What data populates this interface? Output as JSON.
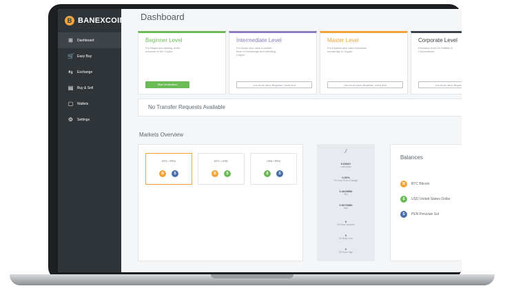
{
  "brand": {
    "name": "BANEXCOIN",
    "mark": "B"
  },
  "colors": {
    "accent": "#f0a43a",
    "green": "#6cbb57",
    "purple": "#8c7bbd",
    "blue": "#4b6fa8",
    "sidebar": "#2f3438"
  },
  "sidebar": {
    "items": [
      {
        "label": "Dashboard",
        "icon": "grid-icon",
        "glyph": "⊞",
        "active": true
      },
      {
        "label": "Easy Buy",
        "icon": "cart-icon",
        "glyph": "🛒",
        "active": false
      },
      {
        "label": "Exchange",
        "icon": "exchange-icon",
        "glyph": "⇆",
        "active": false
      },
      {
        "label": "Buy & Sell",
        "icon": "trade-icon",
        "glyph": "▤",
        "active": false
      },
      {
        "label": "Wallets",
        "icon": "wallet-icon",
        "glyph": "▢",
        "active": false
      },
      {
        "label": "Settings",
        "icon": "gear-icon",
        "glyph": "⚙",
        "active": false
      }
    ]
  },
  "main": {
    "title": "Dashboard",
    "levels": [
      {
        "title": "Beginner Level",
        "desc": "For Beginners starting at the universe of the Crypto.",
        "button": "Start Verification"
      },
      {
        "title": "Intermediate Level",
        "desc": "For those who have a certain level of knowledge and handling Crypto.",
        "button": "You must have Beginner Level first"
      },
      {
        "title": "Master Level",
        "desc": "For Experts who have extensive knowledge in Crypto.",
        "button": "You must have Beginner Level first"
      },
      {
        "title": "Corporate Level",
        "desc": "Exclusive level for Entities & Corporations.",
        "button": "You must have Beginner Level first"
      }
    ],
    "transfers": "No Transfer Requests Available",
    "markets_title": "Markets Overview",
    "pairs": [
      {
        "label": "BTC / PEN",
        "a": "B",
        "b": "S"
      },
      {
        "label": "BTC / USD",
        "a": "B",
        "b": "$"
      },
      {
        "label": "USD / PEN",
        "a": "$",
        "b": "S"
      }
    ],
    "stats": {
      "head": "/",
      "items": [
        {
          "value": "0.0483+",
          "label": "Last price"
        },
        {
          "value": "0.00%",
          "label": "24 Hour Price Change"
        },
        {
          "value": "0.4029856",
          "label": "Bid"
        },
        {
          "value": "0.0079386",
          "label": "Ask"
        },
        {
          "value": "0",
          "label": "24 Hour Volume"
        },
        {
          "value": "0",
          "label": "24 Hour Low"
        },
        {
          "value": "0",
          "label": "24 Hour High"
        }
      ]
    },
    "balances_title": "Balances",
    "balances": [
      {
        "label": "BTC Bitcoin",
        "glyph": "B"
      },
      {
        "label": "USD United States Dollar",
        "glyph": "$"
      },
      {
        "label": "PEN Peruvian Sol",
        "glyph": "S"
      }
    ]
  }
}
